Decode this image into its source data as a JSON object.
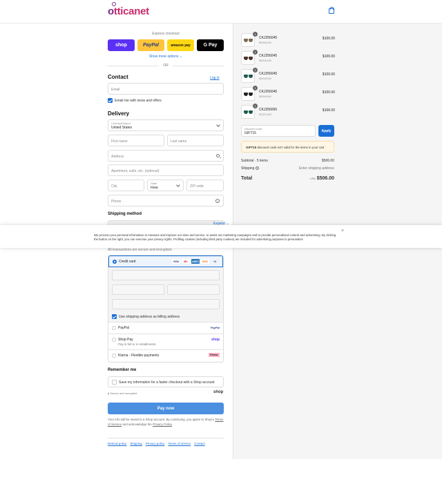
{
  "brand": {
    "logo_part1": "o",
    "logo_part2": "tticanet"
  },
  "express": {
    "title": "Express checkout",
    "shop_pay": "shop",
    "paypal": "PayPal",
    "amazon_pay": "amazon pay",
    "google_pay": "G Pay",
    "show_more": "Show more options ⌄",
    "or": "OR"
  },
  "contact": {
    "heading": "Contact",
    "login": "Log in",
    "email_placeholder": "Email",
    "email_news_label": "Email me with news and offers"
  },
  "delivery": {
    "heading": "Delivery",
    "country_label": "Country/Region",
    "country_value": "United States",
    "first_name": "First name",
    "last_name": "Last name",
    "address": "Address",
    "apartment": "Apartment, suite, etc. (optional)",
    "city": "City",
    "state_label": "State",
    "state_value": "Iowa",
    "zip": "ZIP code",
    "phone": "Phone"
  },
  "shipping": {
    "heading": "Shipping method",
    "expand": "Expand ⌄"
  },
  "cookie": {
    "text": "We process your personal information to measure and improve our sites and service, to assist our marketing campaigns and to provide personalised content and advertising. By clicking the button on the right, you can exercise your privacy rights. Profiling cookies (including third party cookies) are included for advertising purposes to personalize",
    "close": "×"
  },
  "payment": {
    "secure_note": "All transactions are secure and encrypted.",
    "credit_card": "Credit card",
    "card_logos": [
      "VISA",
      "MC",
      "AMEX",
      "DISC",
      "+4"
    ],
    "billing_same": "Use shipping address as billing address",
    "paypal": "PayPal",
    "paypal_logo": "PayPal",
    "shop_pay": "Shop Pay",
    "shop_pay_sub": "Pay in full or in installments",
    "shop_pay_logo": "shop",
    "klarna": "Klarna - Flexible payments",
    "klarna_logo": "Klarna."
  },
  "remember": {
    "heading": "Remember me",
    "label": "Save my information for a faster checkout with a Shop account",
    "secured": "Secure and encrypted",
    "shop_logo": "shop"
  },
  "pay_now": "Pay now",
  "terms": {
    "text1": "Your info will be saved to a Shop account. By continuing, you agree to Shop's",
    "tos": "Terms of Service",
    "text2": "and acknowledge the",
    "privacy": "Privacy Policy",
    "text3": "."
  },
  "footer_links": [
    "Refund policy",
    "Shipping",
    "Privacy policy",
    "Terms of service",
    "Contact"
  ],
  "cart": {
    "items": [
      {
        "qty": "1",
        "name": "CKJ256045",
        "sub": "55/16/140",
        "price": "$100.00",
        "lens": "#7a6a55"
      },
      {
        "qty": "1",
        "name": "CKJ256045",
        "sub": "55/16/140",
        "price": "$100.00",
        "lens": "#4b3128"
      },
      {
        "qty": "1",
        "name": "CKJ256045",
        "sub": "55/16/140",
        "price": "$100.00",
        "lens": "#1f5a4e"
      },
      {
        "qty": "1",
        "name": "CKJ256045",
        "sub": "55/16/140",
        "price": "$100.00",
        "lens": "#222222"
      },
      {
        "qty": "1",
        "name": "CKJ256065",
        "sub": "52/21/140",
        "price": "$106.00",
        "lens": "#1f5a4e"
      }
    ],
    "discount_label": "Discount code",
    "discount_value": "GIFT15",
    "apply": "Apply",
    "alert_code": "GIFT15",
    "alert_text": "discount code isn't valid for the items in your cart",
    "subtotal_label": "Subtotal · 5 items",
    "subtotal_value": "$506.00",
    "shipping_label": "Shipping",
    "shipping_value": "Enter shipping address",
    "total_label": "Total",
    "currency": "USD",
    "total_value": "$506.00"
  }
}
